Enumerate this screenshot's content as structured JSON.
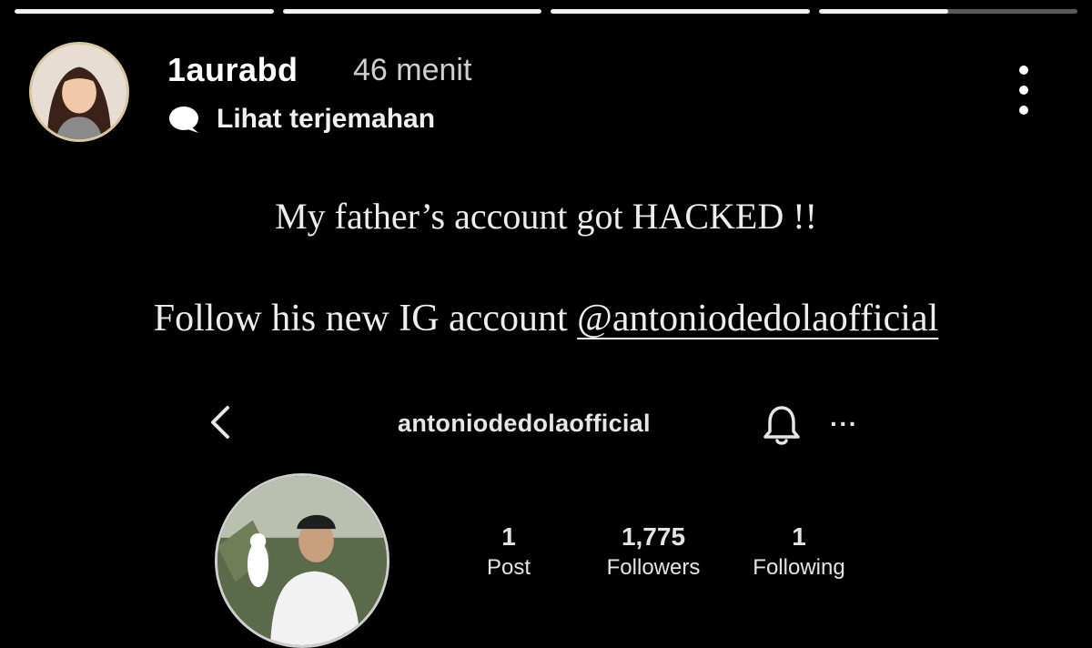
{
  "story": {
    "progress_segments": [
      1,
      1,
      1,
      0.5
    ],
    "user": {
      "username": "1aurabd",
      "time": "46 menit",
      "translate_label": "Lihat terjemahan",
      "avatar_icon": "avatar-icon"
    },
    "more_icon": "more-vertical-icon",
    "text": {
      "line1": "My father’s account got HACKED !!",
      "line2_prefix": "Follow his new IG account ",
      "line2_mention": "@antoniodedolaofficial"
    }
  },
  "embedded_profile": {
    "back_icon": "chevron-left-icon",
    "handle": "antoniodedolaofficial",
    "bell_icon": "bell-icon",
    "more_label": "···",
    "stats": [
      {
        "value": "1",
        "label": "Post"
      },
      {
        "value": "1,775",
        "label": "Followers"
      },
      {
        "value": "1",
        "label": "Following"
      }
    ]
  }
}
